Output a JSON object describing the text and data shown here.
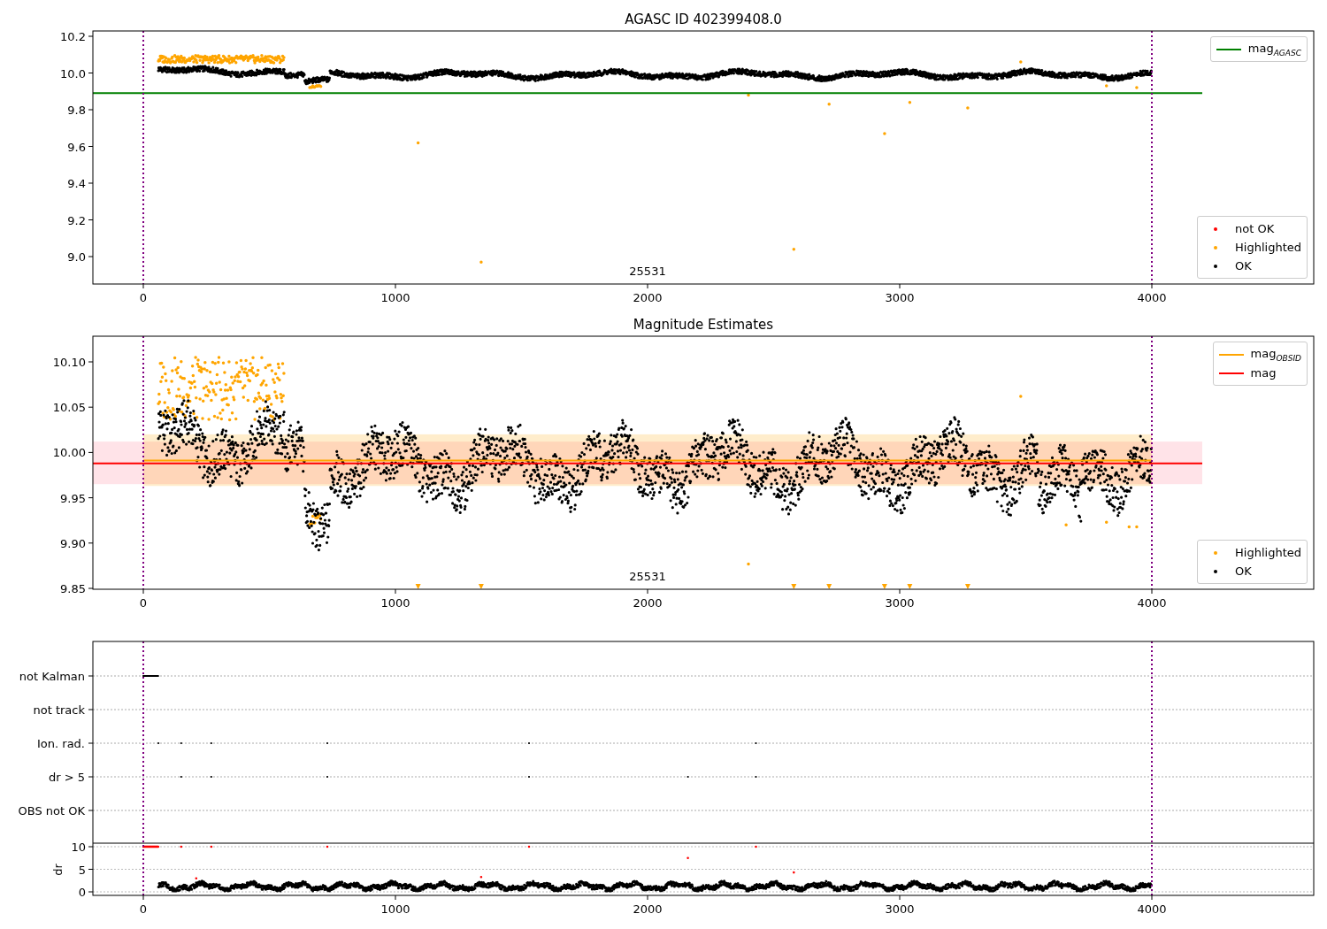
{
  "figure": {
    "panels": [
      {
        "kind": "scatter",
        "title": "AGASC ID 402399408.0",
        "xticks": [
          "0",
          "1000",
          "2000",
          "3000",
          "4000"
        ],
        "yticks": [
          "10.2",
          "10.0",
          "9.8",
          "9.6",
          "9.4",
          "9.2",
          "9.0"
        ],
        "annotation": "25531",
        "legends": [
          {
            "items": [
              {
                "kind": "line",
                "label": "mag$_{AGASC}$",
                "color": "#008000"
              }
            ]
          },
          {
            "items": [
              {
                "kind": "marker",
                "label": "not OK",
                "color": "#ff0000"
              },
              {
                "kind": "marker",
                "label": "Highlighted",
                "color": "#ffa500"
              },
              {
                "kind": "marker",
                "label": "OK",
                "color": "#000000"
              }
            ]
          }
        ]
      },
      {
        "kind": "scatter",
        "title": "Magnitude Estimates",
        "xticks": [
          "0",
          "1000",
          "2000",
          "3000",
          "4000"
        ],
        "yticks": [
          "10.10",
          "10.05",
          "10.00",
          "9.95",
          "9.90",
          "9.85"
        ],
        "annotation": "25531",
        "legends": [
          {
            "items": [
              {
                "kind": "line",
                "label": "mag$_{OBSID}$",
                "color": "#ffa500"
              },
              {
                "kind": "line",
                "label": "mag",
                "color": "#ff0000"
              }
            ]
          },
          {
            "items": [
              {
                "kind": "marker",
                "label": "Highlighted",
                "color": "#ffa500"
              },
              {
                "kind": "marker",
                "label": "OK",
                "color": "#000000"
              }
            ]
          }
        ]
      },
      {
        "kind": "flags",
        "categories": [
          "not Kalman",
          "not track",
          "Ion. rad.",
          "dr > 5",
          "OBS not OK"
        ],
        "ylabel": "dr",
        "yticks": [
          "10",
          "5",
          "0"
        ],
        "xticks": [
          "0",
          "1000",
          "2000",
          "3000",
          "4000"
        ]
      }
    ]
  }
}
